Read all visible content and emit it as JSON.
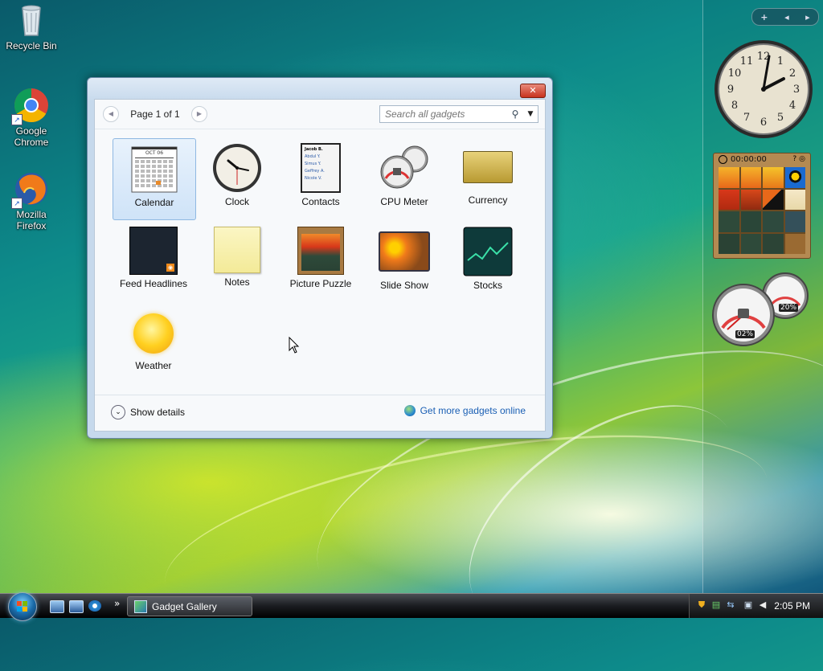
{
  "desktop": {
    "icons": [
      {
        "label": "Recycle Bin",
        "icon": "recycle-bin-icon"
      },
      {
        "label": "Google Chrome",
        "icon": "chrome-icon"
      },
      {
        "label": "Mozilla Firefox",
        "icon": "firefox-icon"
      }
    ]
  },
  "sidebar": {
    "controls": {
      "add": "+",
      "prev": "◂",
      "next": "▸"
    },
    "clock": {
      "hour": 2,
      "minute": 5
    },
    "puzzle": {
      "timer": "00:00:00"
    },
    "cpu": {
      "cpu": "02%",
      "memory": "20%"
    }
  },
  "gallery": {
    "title": "Gadget Gallery",
    "page": "Page 1 of 1",
    "search_placeholder": "Search all gadgets",
    "gadgets": [
      {
        "name": "Calendar",
        "icon": "calendar-icon",
        "selected": true
      },
      {
        "name": "Clock",
        "icon": "clock-icon"
      },
      {
        "name": "Contacts",
        "icon": "contacts-icon"
      },
      {
        "name": "CPU Meter",
        "icon": "cpu-meter-icon"
      },
      {
        "name": "Currency",
        "icon": "currency-icon"
      },
      {
        "name": "Feed Headlines",
        "icon": "feed-headlines-icon"
      },
      {
        "name": "Notes",
        "icon": "notes-icon"
      },
      {
        "name": "Picture Puzzle",
        "icon": "picture-puzzle-icon"
      },
      {
        "name": "Slide Show",
        "icon": "slide-show-icon"
      },
      {
        "name": "Stocks",
        "icon": "stocks-icon"
      },
      {
        "name": "Weather",
        "icon": "weather-icon"
      }
    ],
    "calendar_month": "OCT 06",
    "contacts_preview": [
      "Jacob B.",
      "Abdul Y.",
      "Simus Y.",
      "Geffrey A.",
      "Nicole V."
    ],
    "show_details": "Show details",
    "get_more": "Get more gadgets online"
  },
  "taskbar": {
    "button_label": "Gadget Gallery",
    "clock": "2:05 PM",
    "overflow": "»"
  }
}
